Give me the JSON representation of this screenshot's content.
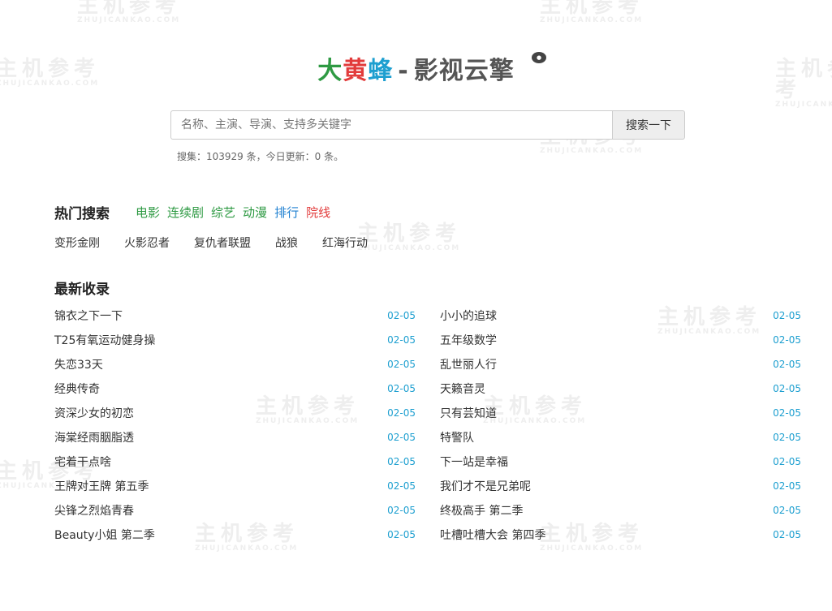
{
  "logo": {
    "part1": "大",
    "part2": "黄",
    "part3": "蜂",
    "dash": "-",
    "rest": "影视云擎"
  },
  "search": {
    "placeholder": "名称、主演、导演、支持多关键字",
    "button_label": "搜索一下"
  },
  "stats": "搜集：103929 条，今日更新：0 条。",
  "hot": {
    "title": "热门搜索",
    "categories": [
      {
        "label": "电影",
        "color": "#2e9a43"
      },
      {
        "label": "连续剧",
        "color": "#2e9a43"
      },
      {
        "label": "综艺",
        "color": "#2e9a43"
      },
      {
        "label": "动漫",
        "color": "#2e9a43"
      },
      {
        "label": "排行",
        "color": "#1d7fd0"
      },
      {
        "label": "院线",
        "color": "#e23c3c"
      }
    ],
    "items": [
      "变形金刚",
      "火影忍者",
      "复仇者联盟",
      "战狼",
      "红海行动"
    ]
  },
  "latest": {
    "title": "最新收录",
    "left": [
      {
        "name": "锦衣之下一下",
        "date": "02-05"
      },
      {
        "name": "T25有氧运动健身操",
        "date": "02-05"
      },
      {
        "name": "失恋33天",
        "date": "02-05"
      },
      {
        "name": "经典传奇",
        "date": "02-05"
      },
      {
        "name": "资深少女的初恋",
        "date": "02-05"
      },
      {
        "name": "海棠经雨胭脂透",
        "date": "02-05"
      },
      {
        "name": "宅着干点啥",
        "date": "02-05"
      },
      {
        "name": "王牌对王牌 第五季",
        "date": "02-05"
      },
      {
        "name": "尖锋之烈焰青春",
        "date": "02-05"
      },
      {
        "name": "Beauty小姐 第二季",
        "date": "02-05"
      }
    ],
    "right": [
      {
        "name": "小小的追球",
        "date": "02-05"
      },
      {
        "name": "五年级数学",
        "date": "02-05"
      },
      {
        "name": "乱世丽人行",
        "date": "02-05"
      },
      {
        "name": "天籁音灵",
        "date": "02-05"
      },
      {
        "name": "只有芸知道",
        "date": "02-05"
      },
      {
        "name": "特警队",
        "date": "02-05"
      },
      {
        "name": "下一站是幸福",
        "date": "02-05"
      },
      {
        "name": "我们才不是兄弟呢",
        "date": "02-05"
      },
      {
        "name": "终极高手 第二季",
        "date": "02-05"
      },
      {
        "name": "吐槽吐槽大会 第四季",
        "date": "02-05"
      }
    ]
  },
  "watermark": {
    "text": "主机参考",
    "sub": "ZHUJICANKAO.COM"
  }
}
